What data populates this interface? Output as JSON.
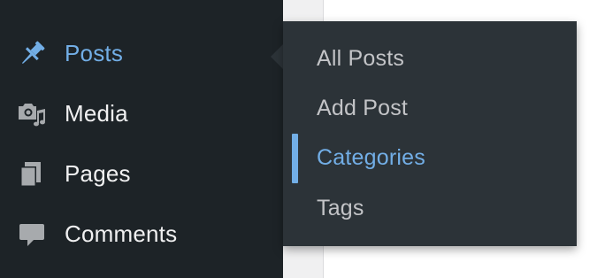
{
  "sidebar": {
    "items": [
      {
        "label": "Posts",
        "icon": "pushpin-icon",
        "active": true
      },
      {
        "label": "Media",
        "icon": "media-icon",
        "active": false
      },
      {
        "label": "Pages",
        "icon": "pages-icon",
        "active": false
      },
      {
        "label": "Comments",
        "icon": "comment-icon",
        "active": false
      }
    ]
  },
  "flyout": {
    "items": [
      {
        "label": "All Posts",
        "current": false
      },
      {
        "label": "Add Post",
        "current": false
      },
      {
        "label": "Categories",
        "current": true
      },
      {
        "label": "Tags",
        "current": false
      }
    ]
  },
  "colors": {
    "sidebar_bg": "#1d2327",
    "flyout_bg": "#2c3338",
    "accent": "#72aee6",
    "text": "#f0f0f1",
    "sub_text": "#c3c4c7",
    "icon": "#a7aaad"
  }
}
